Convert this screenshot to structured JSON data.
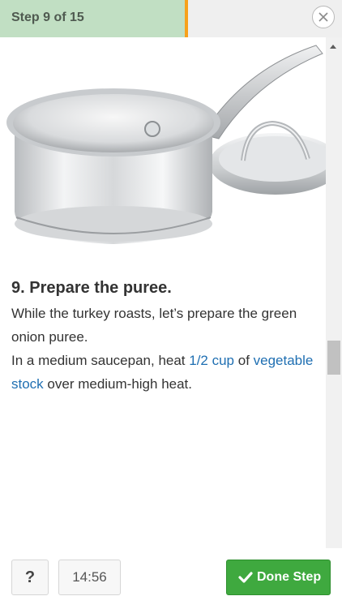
{
  "header": {
    "step_label": "Step 9 of 15",
    "progress_fraction": 0.54,
    "progress_color": "#c1dfc3",
    "marker_color": "#f7a11a"
  },
  "close_button": {
    "icon": "close-icon"
  },
  "image": {
    "description_icon": "saucepan-photo"
  },
  "step": {
    "title": "9. Prepare the puree.",
    "paragraph1": "While the turkey roasts, let’s prepare the green onion puree.",
    "paragraph2_before": "In a medium saucepan, heat ",
    "quantity": "1/2 cup",
    "paragraph2_middle": " of ",
    "ingredient": "vegetable stock",
    "paragraph2_after": " over medium-high heat."
  },
  "footer": {
    "help_label": "?",
    "timer": "14:56",
    "done_label": "Done Step",
    "done_icon": "checkmark-icon",
    "done_color": "#3fa93f"
  }
}
